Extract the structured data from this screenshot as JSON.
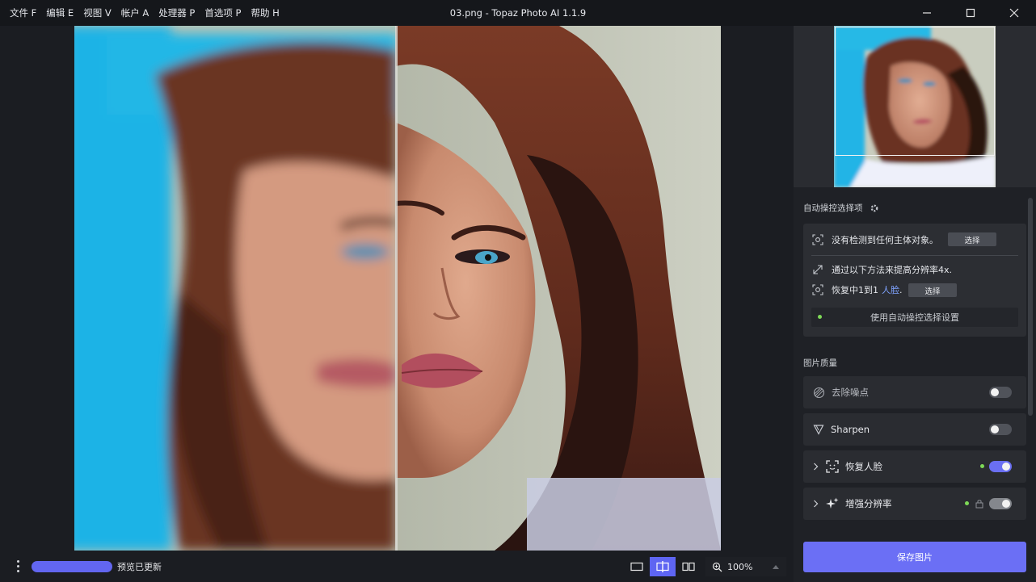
{
  "menu": [
    {
      "label": "文件 F"
    },
    {
      "label": "编辑 E"
    },
    {
      "label": "视图 V"
    },
    {
      "label": "帐户 A"
    },
    {
      "label": "处理器 P"
    },
    {
      "label": "首选项 P"
    },
    {
      "label": "帮助 H"
    }
  ],
  "window": {
    "title": "03.png - Topaz Photo AI 1.1.9"
  },
  "bottom_bar": {
    "status": "预览已更新",
    "progress_fraction": 1.0,
    "zoom": "100%",
    "active_view": "split"
  },
  "autopilot": {
    "heading": "自动操控选择项",
    "no_subject": "没有检测到任何主体对象。",
    "select_label": "选择",
    "upscale_text": "通过以下方法来提高分辨率4x.",
    "face_text_prefix": "恢复中1到1",
    "face_link": "人脸",
    "face_text_suffix": ".",
    "use_auto": "使用自动操控选择设置"
  },
  "quality": {
    "heading": "图片质量",
    "items": [
      {
        "label": "去除噪点",
        "enabled": false,
        "expandable": false
      },
      {
        "label": "Sharpen",
        "enabled": false,
        "expandable": false
      },
      {
        "label": "恢复人脸",
        "enabled": true,
        "expandable": true
      },
      {
        "label": "增强分辨率",
        "enabled": true,
        "expandable": true,
        "locked": true
      }
    ]
  },
  "save_label": "保存图片",
  "colors": {
    "accent": "#6b6ff5",
    "status_dot": "#7ed957",
    "link": "#7fa3ff"
  }
}
